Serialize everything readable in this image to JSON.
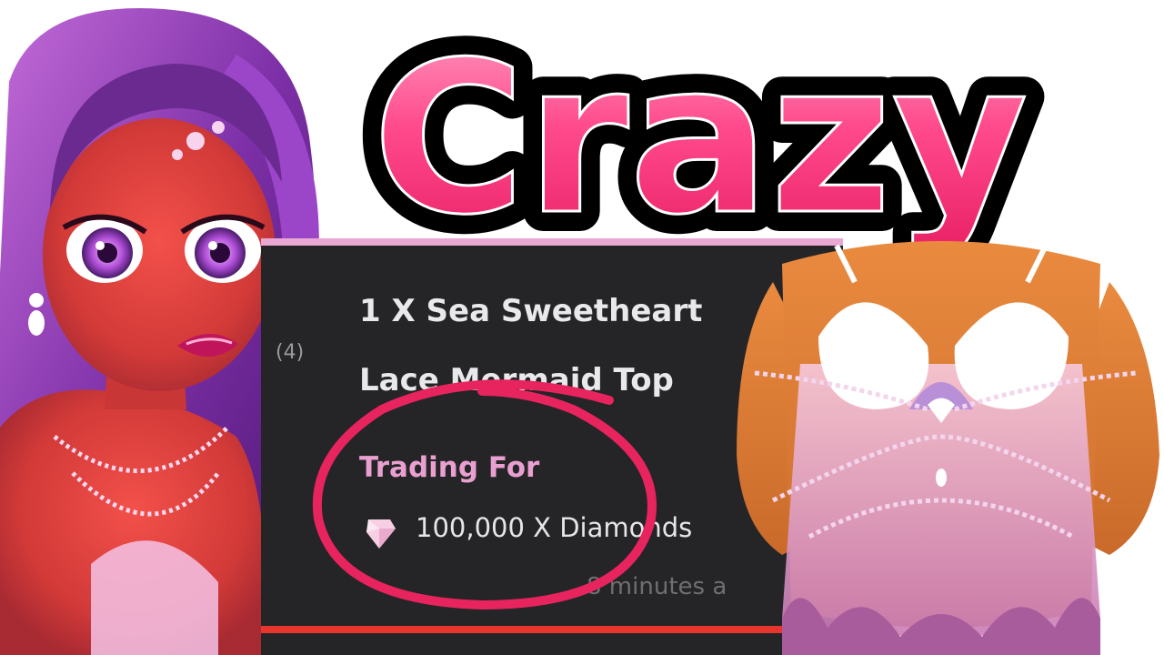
{
  "title": "Crazy",
  "trade_card": {
    "item_line_1": "1 X Sea Sweetheart",
    "item_line_2": "Lace Mermaid Top",
    "trading_label": "Trading For",
    "price": "100,000 X Diamonds",
    "time": "8 minutes a",
    "side_count": "(4)",
    "currency_icon": "diamond-icon"
  },
  "colors": {
    "title_fill": "#ff3f86",
    "title_outline": "#000000",
    "card_background": "#252527",
    "card_top_border": "#e9a8d4",
    "card_bottom_bar": "#e8362f",
    "trading_label": "#e9a0d0",
    "circle_annotation": "#e8245f"
  }
}
